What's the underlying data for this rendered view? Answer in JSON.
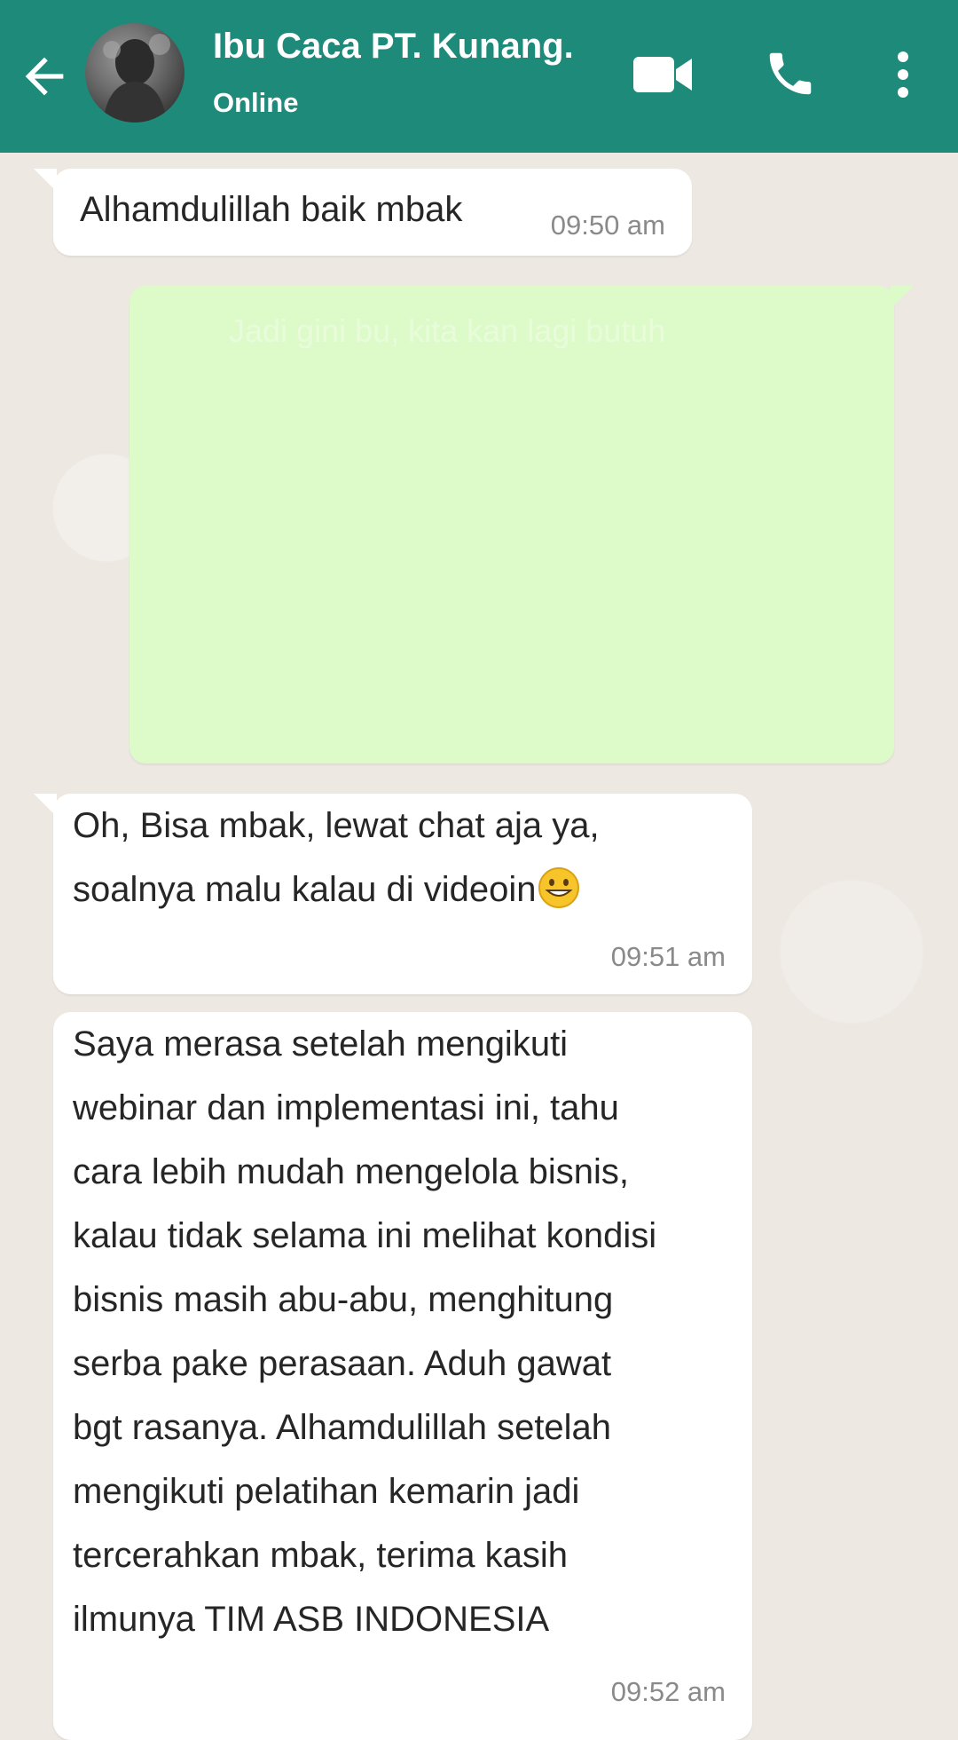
{
  "header": {
    "contact_name": "Ibu Caca PT. Kunang.",
    "status": "Online",
    "icons": [
      "back-arrow-icon",
      "avatar",
      "video-call-icon",
      "phone-call-icon",
      "more-options-icon"
    ],
    "background_color": "#1e8a7a"
  },
  "messages": [
    {
      "direction": "incoming",
      "text": "Alhamdulillah baik mbak",
      "time": "09:50 am"
    },
    {
      "direction": "outgoing",
      "text": "Jadi gini bu, kita kan lagi butuh",
      "time": "",
      "background_color": "#ddfac9"
    },
    {
      "direction": "incoming",
      "text": "Oh, Bisa mbak, lewat chat aja ya,\nsoalnya malu kalau di videoin",
      "emoji": "grinning-face-icon",
      "time": "09:51 am"
    },
    {
      "direction": "incoming",
      "text": "Saya merasa setelah mengikuti\nwebinar dan implementasi ini, tahu\ncara lebih mudah mengelola bisnis,\nkalau tidak selama ini melihat kondisi\nbisnis masih abu-abu, menghitung\nserba pake perasaan. Aduh gawat\nbgt rasanya. Alhamdulillah setelah\nmengikuti pelatihan kemarin jadi\ntercerahkan mbak, terima kasih\nilmunya TIM ASB INDONESIA",
      "time": "09:52 am"
    }
  ]
}
